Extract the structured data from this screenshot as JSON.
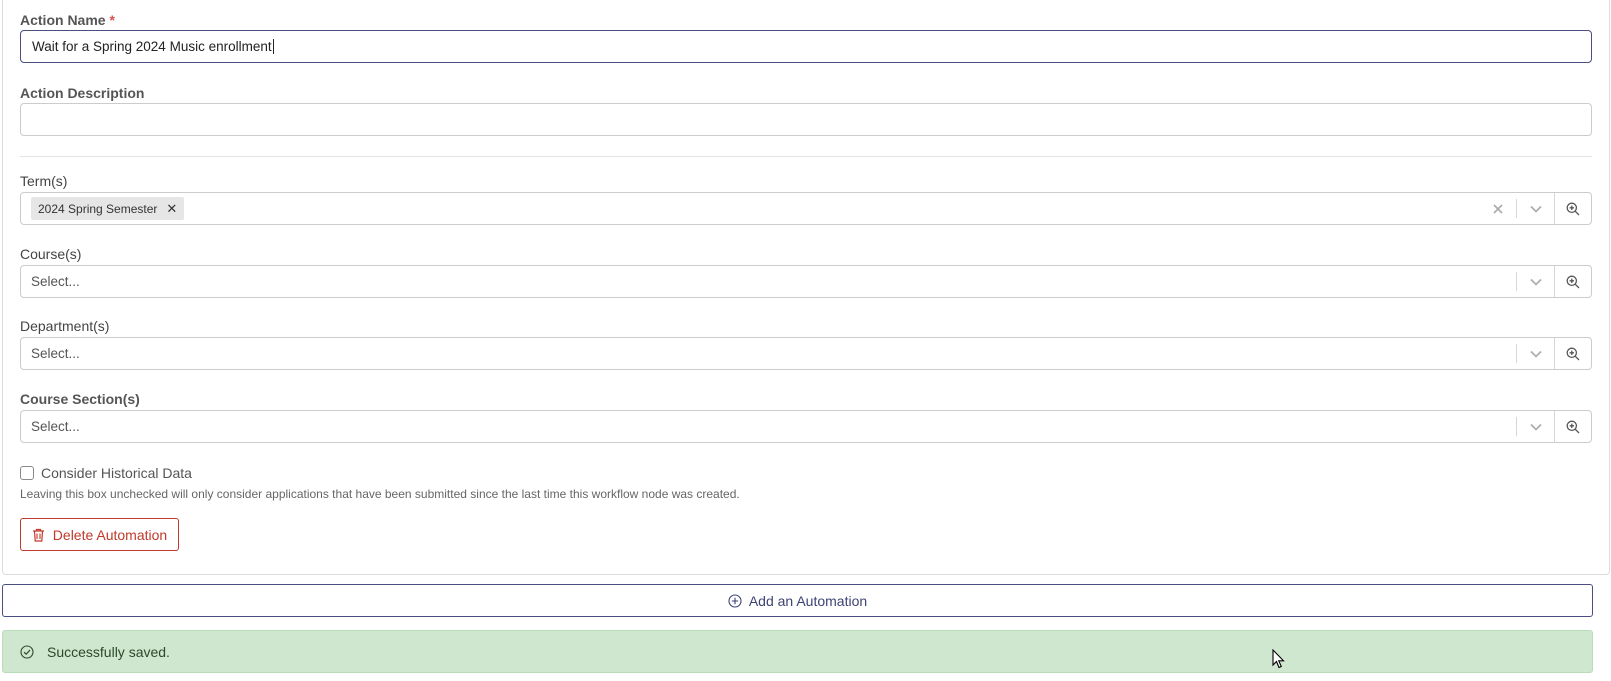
{
  "form": {
    "action_name": {
      "label": "Action Name",
      "required_mark": "*",
      "value": "Wait for a Spring 2024 Music enrollment"
    },
    "action_description": {
      "label": "Action Description",
      "value": ""
    },
    "terms": {
      "label": "Term(s)",
      "selected": [
        "2024 Spring Semester"
      ]
    },
    "courses": {
      "label": "Course(s)",
      "placeholder": "Select..."
    },
    "departments": {
      "label": "Department(s)",
      "placeholder": "Select..."
    },
    "course_sections": {
      "label": "Course Section(s)",
      "placeholder": "Select..."
    },
    "historical": {
      "label": "Consider Historical Data",
      "checked": false,
      "hint": "Leaving this box unchecked will only consider applications that have been submitted since the last time this workflow node was created."
    },
    "delete_label": "Delete Automation"
  },
  "add_automation_label": "Add an Automation",
  "alert": {
    "message": "Successfully saved."
  },
  "icons": {
    "remove": "x-icon",
    "clear": "clear-icon",
    "dropdown": "chevron-down-icon",
    "zoom": "zoom-in-icon",
    "trash": "trash-icon",
    "plus": "plus-circle-icon",
    "check": "check-circle-icon"
  },
  "colors": {
    "danger": "#c0392b",
    "primary": "#4a4e80",
    "success_bg": "#cfe6cf"
  }
}
